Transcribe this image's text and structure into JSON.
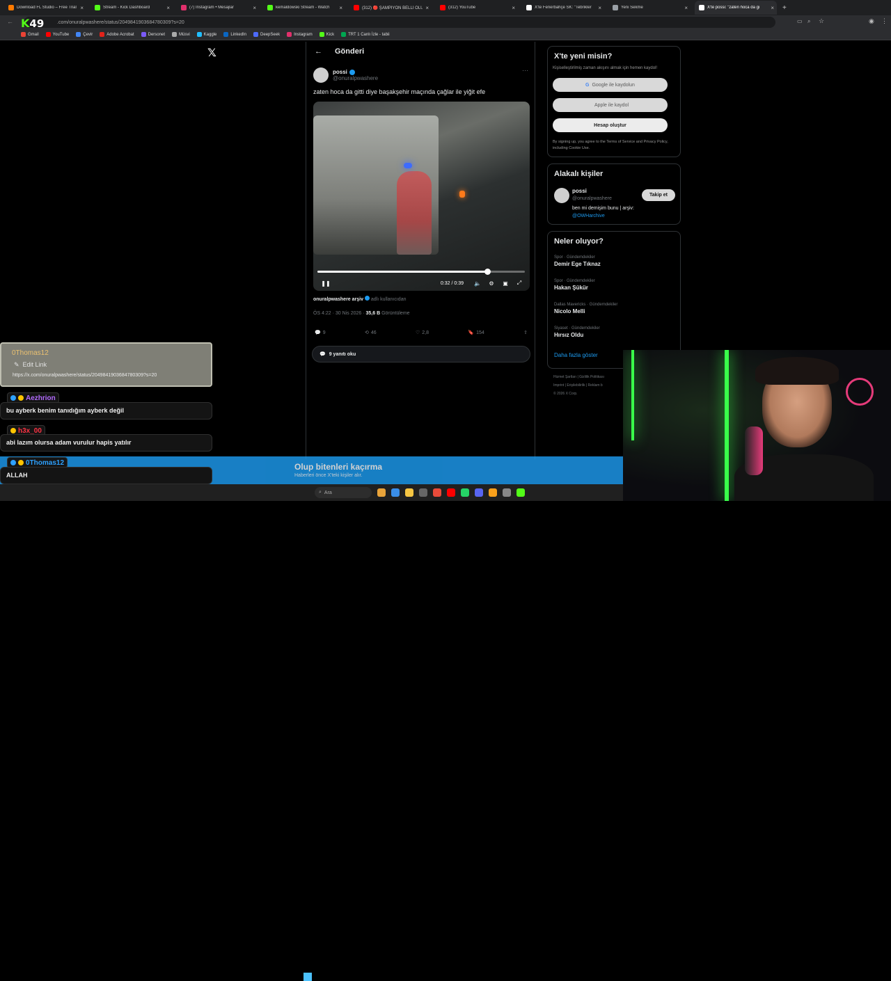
{
  "browser": {
    "tabs": [
      {
        "title": "Download FL Studio – Free Trial",
        "color": "#ff7a00",
        "active": false
      },
      {
        "title": "Stream - Kick Dashboard",
        "color": "#53fc18",
        "active": false
      },
      {
        "title": "(7) Instagram • Mesajlar",
        "color": "#e1306c",
        "active": false
      },
      {
        "title": "kemaldowski Stream - Watch",
        "color": "#53fc18",
        "active": false
      },
      {
        "title": "(312) 🔴 ŞAMPİYON BELLİ OLU",
        "color": "#ff0000",
        "active": false
      },
      {
        "title": "(312) YouTube",
        "color": "#ff0000",
        "active": false
      },
      {
        "title": "X'te Fenerbahçe SK: \"Tebrikler",
        "color": "#ffffff",
        "active": false
      },
      {
        "title": "Yeni Sekme",
        "color": "#9aa0a6",
        "active": false
      },
      {
        "title": "X'te possi: \"zaten hoca da gi",
        "color": "#ffffff",
        "active": true
      }
    ],
    "url": ".com/onuralpwashere/status/2049841903684780309?s=20",
    "bookmarks": [
      "Gmail",
      "YouTube",
      "Çevir",
      "Adobe Acrobat",
      "Dersonet",
      "Müsvi",
      "Kaggle",
      "LinkedIn",
      "DeepSeek",
      "Instagram",
      "Kick",
      "TRT 1 Canlı İzle - tabii"
    ],
    "overlay_logo_k": "K",
    "overlay_logo_num": "49"
  },
  "x_logo": "𝕏",
  "post": {
    "header_title": "Gönderi",
    "author_name": "possi",
    "author_handle": "@onuralpwashere",
    "text": "zaten hoca da gitti diye başakşehir maçında çağlar ile yiğit efe",
    "video_time": "0:32 / 0:39",
    "progress": 0.82,
    "source_account": "onuralpwashere arşiv",
    "source_suffix": "adlı kullanıcıdan",
    "date": "ÖS 4:22 · 30 Nis 2026 ·",
    "views": "35,6 B",
    "views_label": "Görüntüleme",
    "replies_count": "9",
    "reposts_count": "46",
    "likes_count": "2,8",
    "bookmarks_count": "154",
    "read_replies": "9 yanıtı oku"
  },
  "signup": {
    "title": "X'te yeni misin?",
    "subtitle": "Kişiselleştirilmiş zaman akışını almak için hemen kaydol!",
    "google": "Google ile kaydolun",
    "apple": "Apple ile kaydol",
    "create": "Hesap oluştur",
    "legal": "By signing up, you agree to the Terms of Service and Privacy Policy, including Cookie Use."
  },
  "related": {
    "title": "Alakalı kişiler",
    "name": "possi",
    "handle": "@onuralpwashere",
    "follow": "Takip et",
    "bio": "ben mi demişim bunu | arşiv:",
    "bio_link": "@OWHarchive"
  },
  "trends": {
    "title": "Neler oluyor?",
    "items": [
      {
        "category": "Spor · Gündemdekiler",
        "name": "Demir Ege Tıknaz"
      },
      {
        "category": "Spor · Gündemdekiler",
        "name": "Hakan Şükür"
      },
      {
        "category": "Dallas Mavericks · Gündemdekiler",
        "name": "Nicolo Melli"
      },
      {
        "category": "Siyaset · Gündemdekiler",
        "name": "Hırsız Oldu"
      }
    ],
    "show_more": "Daha fazla göster"
  },
  "footer": {
    "line1": "Hizmet Şartları | Gizlilik Politikası",
    "line2": "Imprint | Erişilebilirlik | Reklam b",
    "line3": "© 2026 X Corp."
  },
  "chat": {
    "link_user": "0Thomas12",
    "edit_link": "Edit Link",
    "link_url": "https://x.com/onuralpwashere/status/2049841903684780309?s=20",
    "messages": [
      {
        "user": "Aezhrion",
        "user_color": "#b36bff",
        "text": "bu ayberk benim tanıdığım ayberk değil"
      },
      {
        "user": "h3x_00",
        "user_color": "#ff3344",
        "text": "abi lazım olursa adam vurulur hapis yatılır"
      },
      {
        "user": "0Thomas12",
        "user_color": "#2ea1ff",
        "text": "ALLAH"
      },
      {
        "user": "0Thomas12",
        "user_color": "#2ea1ff",
        "text": ""
      }
    ]
  },
  "banner": {
    "title": "Olup bitenleri kaçırma",
    "subtitle": "Haberleri önce X'teki kişiler alır."
  },
  "taskbar": {
    "search_placeholder": "Ara"
  }
}
